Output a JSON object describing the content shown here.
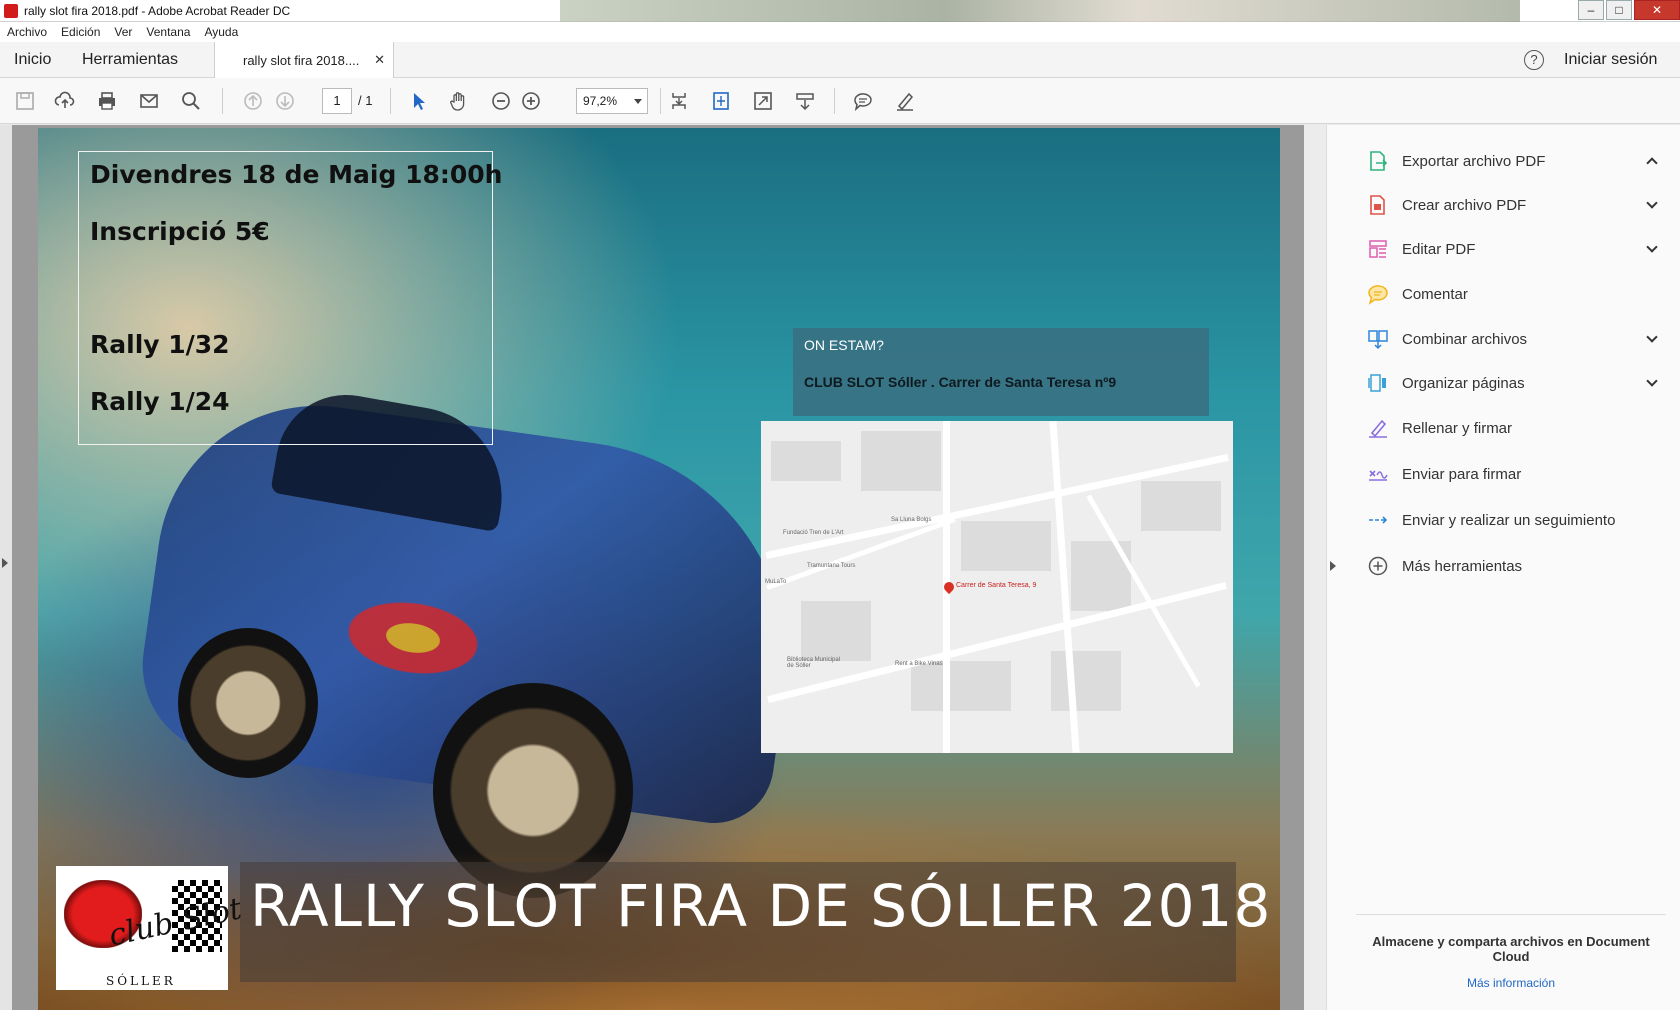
{
  "window": {
    "title": "rally slot fira 2018.pdf - Adobe Acrobat Reader DC"
  },
  "menu": [
    "Archivo",
    "Edición",
    "Ver",
    "Ventana",
    "Ayuda"
  ],
  "tabs": {
    "home": "Inicio",
    "tools": "Herramientas",
    "document": "rally slot fira 2018....",
    "help": "?",
    "sign_in": "Iniciar sesión"
  },
  "toolbar": {
    "page_current": "1",
    "page_total": "/ 1",
    "zoom": "97,2%"
  },
  "poster": {
    "line1": "Divendres 18 de Maig 18:00h",
    "line2": "Inscripció  5€",
    "line3": "Rally 1/32",
    "line4": "Rally 1/24",
    "where_title": "ON ESTAM?",
    "where_address": "CLUB SLOT Sóller . Carrer de Santa Teresa nº9",
    "map_pin_label": "Carrer de Santa Teresa, 9",
    "map_labels": [
      "Fundació Tren de L'Art",
      "Tramuntana Tours",
      "Sa Lluna Bolgs",
      "Rent a Bike Vinas",
      "Biblioteca Municipal de Sóller",
      "MuLaTo"
    ],
    "logo_script": "club Slot",
    "logo_town": "SÓLLER",
    "banner": "RALLY SLOT FIRA DE SÓLLER 2018"
  },
  "right_panel": {
    "items": [
      {
        "label": "Exportar archivo PDF",
        "icon": "export-pdf-icon",
        "color": "#2eb57d",
        "chevron": "up"
      },
      {
        "label": "Crear archivo PDF",
        "icon": "create-pdf-icon",
        "color": "#e0524a",
        "chevron": "down"
      },
      {
        "label": "Editar PDF",
        "icon": "edit-pdf-icon",
        "color": "#e05cae",
        "chevron": "down"
      },
      {
        "label": "Comentar",
        "icon": "comment-icon",
        "color": "#f2b51c",
        "chevron": ""
      },
      {
        "label": "Combinar archivos",
        "icon": "combine-icon",
        "color": "#2e86d9",
        "chevron": "down"
      },
      {
        "label": "Organizar páginas",
        "icon": "organize-icon",
        "color": "#3aa1d8",
        "chevron": "down"
      },
      {
        "label": "Rellenar y firmar",
        "icon": "fill-sign-icon",
        "color": "#8a6ee0",
        "chevron": ""
      },
      {
        "label": "Enviar para firmar",
        "icon": "send-sign-icon",
        "color": "#8a6ee0",
        "chevron": ""
      },
      {
        "label": "Enviar y realizar un seguimiento",
        "icon": "send-track-icon",
        "color": "#2e86d9",
        "chevron": ""
      },
      {
        "label": "Más herramientas",
        "icon": "more-tools-icon",
        "color": "#555555",
        "chevron": ""
      }
    ],
    "store_text": "Almacene y comparta archivos en Document Cloud",
    "more_info": "Más información"
  }
}
